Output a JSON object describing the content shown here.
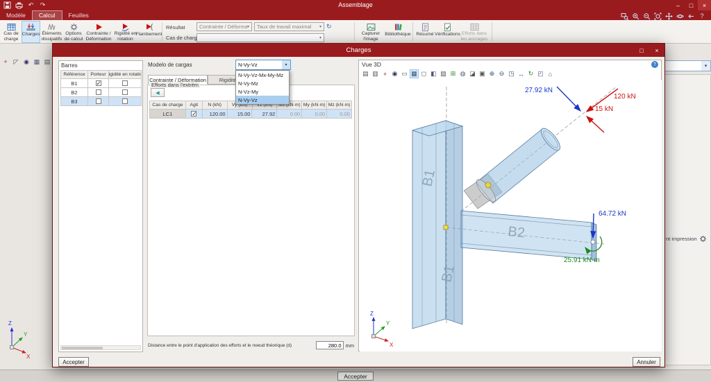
{
  "titlebar": {
    "title": "Assemblage"
  },
  "menubar": {
    "tabs": [
      "Modèle",
      "Calcul",
      "Feuilles"
    ]
  },
  "ribbon": {
    "buttons": [
      {
        "label": "Cas de charge"
      },
      {
        "label": "Charges"
      },
      {
        "label": "Éléments dissipatifs"
      },
      {
        "label": "Options de calcul"
      },
      {
        "label": "Contrainte / Déformation"
      },
      {
        "label": "Rigidité en rotation"
      },
      {
        "label": "Flambement"
      }
    ],
    "result": {
      "label": "Résultat",
      "analysis_value": "Contrainte / Déformation",
      "criteria_value": "Taux de travail maximal",
      "loadcase_label": "Cas de charge",
      "loadcase_value": ""
    },
    "tools": [
      {
        "label": "Capturer l'image"
      },
      {
        "label": "Bibliothèque"
      },
      {
        "label": "Résumé"
      },
      {
        "label": "Vérifications"
      },
      {
        "label": "Efforts dans les ancrages"
      }
    ]
  },
  "dialog": {
    "title": "Charges",
    "barres": {
      "title": "Barres",
      "headers": [
        "Référence",
        "Porteur",
        "Rigidité en rotation"
      ],
      "rows": [
        {
          "ref": "B1",
          "porteur": true,
          "rigidite": false
        },
        {
          "ref": "B2",
          "porteur": false,
          "rigidite": false
        },
        {
          "ref": "B3",
          "porteur": false,
          "rigidite": false
        }
      ]
    },
    "loads": {
      "model_label": "Modelo de cargas",
      "model_value": "N-Vy-Vz",
      "model_options": [
        "N-Vy-Vz-Mx-My-Mz",
        "N-Vy-Mz",
        "N-Vz-My",
        "N-Vy-Vz"
      ],
      "tab1": "Contrainte / Déformation",
      "tab2": "Rigidité en rotation",
      "group_label": "Efforts dans l'extrém",
      "headers": [
        "Cas de charge",
        "Agit",
        "N (kN)",
        "Vy (kN)",
        "Vz (kN)",
        "Mx (kN·m)",
        "My (kN·m)",
        "Mz (kN·m)"
      ],
      "rows": [
        {
          "case": "LC1",
          "agit": true,
          "n": "120.00",
          "vy": "15.00",
          "vz": "27.92",
          "mx": "0.00",
          "my": "0.00",
          "mz": "0.00"
        }
      ],
      "distance_label": "Distance entre le point d'application des efforts et le noeud théorique (d)",
      "distance_value": "280.0",
      "distance_unit": "mm"
    },
    "view3d": {
      "title": "Vue 3D",
      "forces": {
        "vz": "27.92 kN",
        "n": "120 kN",
        "vy": "15 kN",
        "fz": "64.72 kN",
        "moment": "25.91 kN·m"
      },
      "members": {
        "column_top": "B1",
        "column_bottom": "B1",
        "beam": "B2"
      },
      "axes": {
        "x": "X",
        "y": "Y",
        "z": "Z"
      }
    },
    "accept": "Accepter",
    "cancel": "Annuler"
  },
  "workspace": {
    "axes": {
      "x": "X",
      "y": "Y",
      "z": "Z"
    },
    "right_fragment": "nt impression"
  },
  "footer": {
    "accept": "Accepter"
  },
  "icons": {
    "minimize": "–",
    "maximize": "□",
    "close": "×",
    "dialog_maximize": "□",
    "dialog_close": "×",
    "combo_arrow": "▾",
    "back": "◀",
    "help": "?",
    "refresh": "↻",
    "undo": "↶",
    "redo": "↷",
    "v3d": [
      {
        "n": "print",
        "g": "▤",
        "c": "#555"
      },
      {
        "n": "export",
        "g": "▥",
        "c": "#555"
      },
      {
        "n": "axes",
        "g": "+",
        "c": "#a33"
      },
      {
        "n": "eye",
        "g": "◉",
        "c": "#336"
      },
      {
        "n": "measure",
        "g": "▭",
        "c": "#555"
      },
      {
        "n": "solid-view",
        "g": "▦",
        "c": "#357"
      },
      {
        "n": "wireframe-view",
        "g": "◻",
        "c": "#555"
      },
      {
        "n": "shaded-view",
        "g": "◧",
        "c": "#557"
      },
      {
        "n": "transparent-view",
        "g": "▨",
        "c": "#555"
      },
      {
        "n": "grid",
        "g": "⊞",
        "c": "#383"
      },
      {
        "n": "sphere-view",
        "g": "◍",
        "c": "#557"
      },
      {
        "n": "section",
        "g": "◪",
        "c": "#555"
      },
      {
        "n": "screenshot",
        "g": "▣",
        "c": "#555"
      },
      {
        "n": "zoom-in",
        "g": "⊕",
        "c": "#357"
      },
      {
        "n": "zoom-out",
        "g": "⊖",
        "c": "#357"
      },
      {
        "n": "zoom-extents",
        "g": "◳",
        "c": "#357"
      },
      {
        "n": "pan",
        "g": "↔",
        "c": "#357"
      },
      {
        "n": "orbit",
        "g": "↻",
        "c": "#383"
      },
      {
        "n": "front-view",
        "g": "◰",
        "c": "#557"
      },
      {
        "n": "home-view",
        "g": "⌂",
        "c": "#555"
      }
    ],
    "left_tools": [
      {
        "n": "axes",
        "g": "+",
        "c": "#a33"
      },
      {
        "n": "select",
        "g": "◸",
        "c": "#555"
      },
      {
        "n": "eye",
        "g": "◉",
        "c": "#336"
      },
      {
        "n": "box",
        "g": "▦",
        "c": "#557"
      },
      {
        "n": "print",
        "g": "▤",
        "c": "#555"
      }
    ]
  }
}
